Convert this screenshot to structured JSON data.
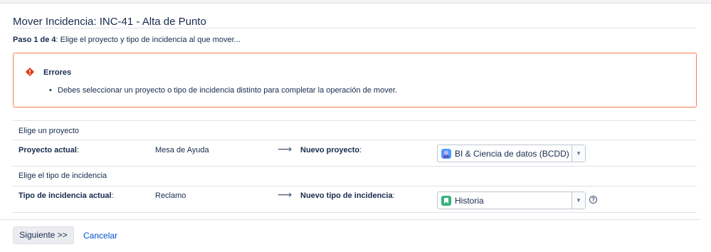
{
  "page": {
    "title": "Mover Incidencia: INC-41 - Alta de Punto",
    "step_bold": "Paso 1 de 4",
    "step_rest": ": Elige el proyecto y tipo de incidencia al que mover..."
  },
  "errors": {
    "title": "Errores",
    "items": [
      "Debes seleccionar un proyecto o tipo de incidencia distinto para completar la operación de mover."
    ],
    "icon": "warning-icon",
    "border_color": "#f87c52",
    "icon_color": "#de350b"
  },
  "project": {
    "section_label": "Elige un proyecto",
    "current_label": "Proyecto actual",
    "current_value": "Mesa de Ayuda",
    "arrow": "⟶",
    "new_label": "Nuevo proyecto",
    "colon": ":",
    "selected": "BI & Ciencia de datos (BCDD)",
    "icon": "project-avatar-icon"
  },
  "issue_type": {
    "section_label": "Elige el tipo de incidencia",
    "current_label": "Tipo de incidencia actual",
    "current_value": "Reclamo",
    "arrow": "⟶",
    "new_label": "Nuevo tipo de incidencia",
    "colon": ":",
    "selected": "Historia",
    "icon": "story-icon",
    "icon_color": "#36b37e",
    "help": "?"
  },
  "actions": {
    "next_label": "Siguiente >>",
    "cancel_label": "Cancelar"
  },
  "colors": {
    "link": "#0052cc",
    "text": "#172b4d"
  }
}
